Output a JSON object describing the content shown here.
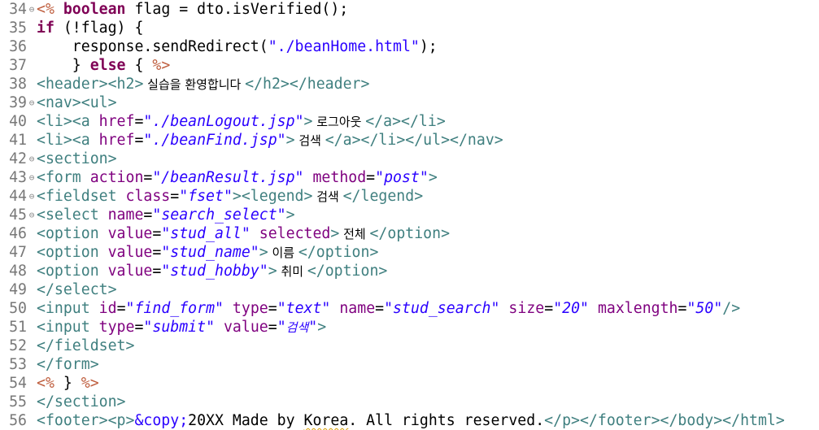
{
  "editor": {
    "lines": [
      {
        "num": "34",
        "fold": "⊖",
        "tokens": [
          {
            "t": "<%",
            "c": "jsp"
          },
          {
            "t": " ",
            "c": "default"
          },
          {
            "t": "boolean",
            "c": "keyword"
          },
          {
            "t": " flag = dto.isVerified();",
            "c": "default"
          }
        ]
      },
      {
        "num": "35",
        "fold": "",
        "tokens": [
          {
            "t": "if",
            "c": "keyword"
          },
          {
            "t": " (!flag) {",
            "c": "default"
          }
        ]
      },
      {
        "num": "36",
        "fold": "",
        "tokens": [
          {
            "t": "    response.sendRedirect(",
            "c": "default"
          },
          {
            "t": "\"./beanHome.html\"",
            "c": "string"
          },
          {
            "t": ");",
            "c": "default"
          }
        ]
      },
      {
        "num": "37",
        "fold": "",
        "tokens": [
          {
            "t": "    } ",
            "c": "default"
          },
          {
            "t": "else",
            "c": "keyword"
          },
          {
            "t": " { ",
            "c": "default"
          },
          {
            "t": "%>",
            "c": "jsp"
          }
        ]
      },
      {
        "num": "38",
        "fold": "",
        "tokens": [
          {
            "t": "<header><h2>",
            "c": "tag"
          },
          {
            "t": " 실습을 환영합니다 ",
            "c": "kor"
          },
          {
            "t": "</h2></header>",
            "c": "tag"
          }
        ]
      },
      {
        "num": "39",
        "fold": "⊖",
        "tokens": [
          {
            "t": "<nav><ul>",
            "c": "tag"
          }
        ]
      },
      {
        "num": "40",
        "fold": "",
        "tokens": [
          {
            "t": "<li><a ",
            "c": "tag"
          },
          {
            "t": "href",
            "c": "attr"
          },
          {
            "t": "=",
            "c": "default"
          },
          {
            "t": "\"./beanLogout.jsp\"",
            "c": "value"
          },
          {
            "t": ">",
            "c": "tag"
          },
          {
            "t": " 로그아웃 ",
            "c": "kor"
          },
          {
            "t": "</a></li>",
            "c": "tag"
          }
        ]
      },
      {
        "num": "41",
        "fold": "",
        "tokens": [
          {
            "t": "<li><a ",
            "c": "tag"
          },
          {
            "t": "href",
            "c": "attr"
          },
          {
            "t": "=",
            "c": "default"
          },
          {
            "t": "\"./beanFind.jsp\"",
            "c": "value"
          },
          {
            "t": ">",
            "c": "tag"
          },
          {
            "t": " 검색 ",
            "c": "kor"
          },
          {
            "t": "</a></li></ul></nav>",
            "c": "tag"
          }
        ]
      },
      {
        "num": "42",
        "fold": "⊖",
        "tokens": [
          {
            "t": "<section>",
            "c": "tag"
          }
        ]
      },
      {
        "num": "43",
        "fold": "⊖",
        "tokens": [
          {
            "t": "<form ",
            "c": "tag"
          },
          {
            "t": "action",
            "c": "attr"
          },
          {
            "t": "=",
            "c": "default"
          },
          {
            "t": "\"/beanResult.jsp\"",
            "c": "value"
          },
          {
            "t": " ",
            "c": "default"
          },
          {
            "t": "method",
            "c": "attr"
          },
          {
            "t": "=",
            "c": "default"
          },
          {
            "t": "\"post\"",
            "c": "value"
          },
          {
            "t": ">",
            "c": "tag"
          }
        ]
      },
      {
        "num": "44",
        "fold": "⊖",
        "tokens": [
          {
            "t": "<fieldset ",
            "c": "tag"
          },
          {
            "t": "class",
            "c": "attr"
          },
          {
            "t": "=",
            "c": "default"
          },
          {
            "t": "\"fset\"",
            "c": "value"
          },
          {
            "t": "><legend>",
            "c": "tag"
          },
          {
            "t": " 검색 ",
            "c": "kor"
          },
          {
            "t": "</legend>",
            "c": "tag"
          }
        ]
      },
      {
        "num": "45",
        "fold": "⊖",
        "tokens": [
          {
            "t": "<select ",
            "c": "tag"
          },
          {
            "t": "name",
            "c": "attr"
          },
          {
            "t": "=",
            "c": "default"
          },
          {
            "t": "\"search_select\"",
            "c": "value"
          },
          {
            "t": ">",
            "c": "tag"
          }
        ]
      },
      {
        "num": "46",
        "fold": "",
        "tokens": [
          {
            "t": "<option ",
            "c": "tag"
          },
          {
            "t": "value",
            "c": "attr"
          },
          {
            "t": "=",
            "c": "default"
          },
          {
            "t": "\"stud_all\"",
            "c": "value"
          },
          {
            "t": " ",
            "c": "default"
          },
          {
            "t": "selected",
            "c": "attr"
          },
          {
            "t": ">",
            "c": "tag"
          },
          {
            "t": " 전체 ",
            "c": "kor"
          },
          {
            "t": "</option>",
            "c": "tag"
          }
        ]
      },
      {
        "num": "47",
        "fold": "",
        "tokens": [
          {
            "t": "<option ",
            "c": "tag"
          },
          {
            "t": "value",
            "c": "attr"
          },
          {
            "t": "=",
            "c": "default"
          },
          {
            "t": "\"stud_name\"",
            "c": "value"
          },
          {
            "t": ">",
            "c": "tag"
          },
          {
            "t": " 이름 ",
            "c": "kor"
          },
          {
            "t": "</option>",
            "c": "tag"
          }
        ]
      },
      {
        "num": "48",
        "fold": "",
        "tokens": [
          {
            "t": "<option ",
            "c": "tag"
          },
          {
            "t": "value",
            "c": "attr"
          },
          {
            "t": "=",
            "c": "default"
          },
          {
            "t": "\"stud_hobby\"",
            "c": "value"
          },
          {
            "t": ">",
            "c": "tag"
          },
          {
            "t": " 취미 ",
            "c": "kor"
          },
          {
            "t": "</option>",
            "c": "tag"
          }
        ]
      },
      {
        "num": "49",
        "fold": "",
        "tokens": [
          {
            "t": "</select>",
            "c": "tag"
          }
        ]
      },
      {
        "num": "50",
        "fold": "",
        "tokens": [
          {
            "t": "<input ",
            "c": "tag"
          },
          {
            "t": "id",
            "c": "attr"
          },
          {
            "t": "=",
            "c": "default"
          },
          {
            "t": "\"find_form\"",
            "c": "value"
          },
          {
            "t": " ",
            "c": "default"
          },
          {
            "t": "type",
            "c": "attr"
          },
          {
            "t": "=",
            "c": "default"
          },
          {
            "t": "\"text\"",
            "c": "value"
          },
          {
            "t": " ",
            "c": "default"
          },
          {
            "t": "name",
            "c": "attr"
          },
          {
            "t": "=",
            "c": "default"
          },
          {
            "t": "\"stud_search\"",
            "c": "value"
          },
          {
            "t": " ",
            "c": "default"
          },
          {
            "t": "size",
            "c": "attr"
          },
          {
            "t": "=",
            "c": "default"
          },
          {
            "t": "\"20\"",
            "c": "value"
          },
          {
            "t": " ",
            "c": "default"
          },
          {
            "t": "maxlength",
            "c": "attr"
          },
          {
            "t": "=",
            "c": "default"
          },
          {
            "t": "\"50\"",
            "c": "value"
          },
          {
            "t": "/>",
            "c": "tag"
          }
        ]
      },
      {
        "num": "51",
        "fold": "",
        "tokens": [
          {
            "t": "<input ",
            "c": "tag"
          },
          {
            "t": "type",
            "c": "attr"
          },
          {
            "t": "=",
            "c": "default"
          },
          {
            "t": "\"submit\"",
            "c": "value"
          },
          {
            "t": " ",
            "c": "default"
          },
          {
            "t": "value",
            "c": "attr"
          },
          {
            "t": "=",
            "c": "default"
          },
          {
            "t": "\"",
            "c": "value"
          },
          {
            "t": "검색",
            "c": "korval"
          },
          {
            "t": "\"",
            "c": "value"
          },
          {
            "t": ">",
            "c": "tag"
          }
        ]
      },
      {
        "num": "52",
        "fold": "",
        "tokens": [
          {
            "t": "</fieldset>",
            "c": "tag"
          }
        ]
      },
      {
        "num": "53",
        "fold": "",
        "tokens": [
          {
            "t": "</form>",
            "c": "tag"
          }
        ]
      },
      {
        "num": "54",
        "fold": "",
        "tokens": [
          {
            "t": "<%",
            "c": "jsp"
          },
          {
            "t": " } ",
            "c": "default"
          },
          {
            "t": "%>",
            "c": "jsp"
          }
        ]
      },
      {
        "num": "55",
        "fold": "",
        "tokens": [
          {
            "t": "</section>",
            "c": "tag"
          }
        ]
      },
      {
        "num": "56",
        "fold": "",
        "tokens": [
          {
            "t": "<footer><p>",
            "c": "tag"
          },
          {
            "t": "&copy;",
            "c": "entity"
          },
          {
            "t": "20XX Made by ",
            "c": "default"
          },
          {
            "t": "Korea",
            "c": "squiggle"
          },
          {
            "t": ". All rights reserved.",
            "c": "default"
          },
          {
            "t": "</p></footer></body></html>",
            "c": "tag"
          }
        ]
      }
    ]
  }
}
